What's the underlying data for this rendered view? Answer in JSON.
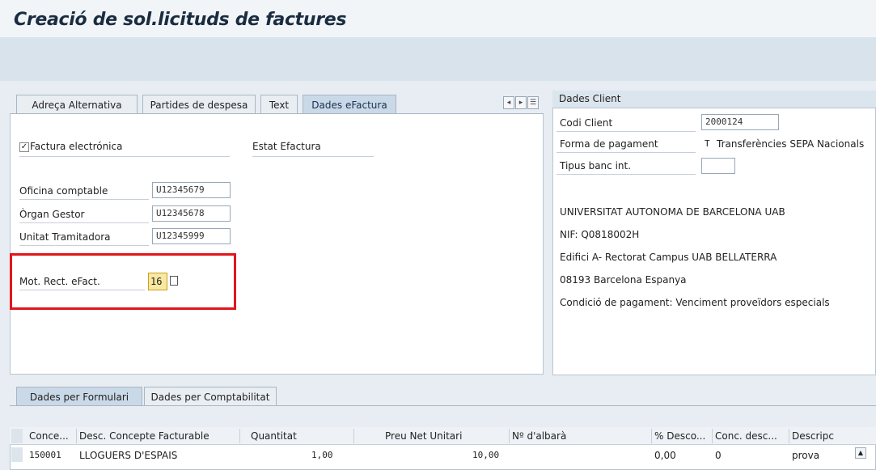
{
  "title": "Creació de sol.licituds de factures",
  "tabs": [
    {
      "label": "Adreça Alternativa"
    },
    {
      "label": "Partides de despesa"
    },
    {
      "label": "Text"
    },
    {
      "label": "Dades eFactura",
      "active": true
    }
  ],
  "efactura": {
    "checkbox_label": "Factura electrónica",
    "checkbox_checked": true,
    "estat_label": "Estat Efactura",
    "oficina_label": "Oficina comptable",
    "oficina_value": "U12345679",
    "organ_label": "Òrgan Gestor",
    "organ_value": "U12345678",
    "unitat_label": "Unitat Tramitadora",
    "unitat_value": "U12345999",
    "mot_label": "Mot. Rect. eFact.",
    "mot_value": "16"
  },
  "client": {
    "header": "Dades Client",
    "codi_label": "Codi Client",
    "codi_value": "2000124",
    "forma_label": "Forma de pagament",
    "forma_code": "T",
    "forma_value": "Transferències SEPA Nacionals",
    "tipus_label": "Tipus banc int.",
    "tipus_value": "",
    "address": [
      "UNIVERSITAT AUTONOMA DE BARCELONA UAB",
      "NIF: Q0818002H",
      "Edifici A- Rectorat Campus UAB BELLATERRA",
      "08193 Barcelona Espanya",
      "Condició de pagament: Venciment proveïdors especials"
    ]
  },
  "bottom_tabs": [
    {
      "label": "Dades per Formulari",
      "active": true
    },
    {
      "label": "Dades per Comptabilitat"
    }
  ],
  "table": {
    "columns": [
      "Conce...",
      "Desc. Concepte Facturable",
      "Quantitat",
      "Preu Net Unitari",
      "Nº d'albarà",
      "% Desco...",
      "Conc. desc...",
      "Descripc"
    ],
    "rows": [
      {
        "conce": "150001",
        "desc": "LLOGUERS D'ESPAIS",
        "quantitat": "1,00",
        "preu": "10,00",
        "albara": "",
        "desco": "0,00",
        "conc_desc": "0",
        "descripc": "prova"
      }
    ]
  },
  "colors": {
    "highlight": "#e0161b",
    "active_tab": "#c9d9e8"
  }
}
